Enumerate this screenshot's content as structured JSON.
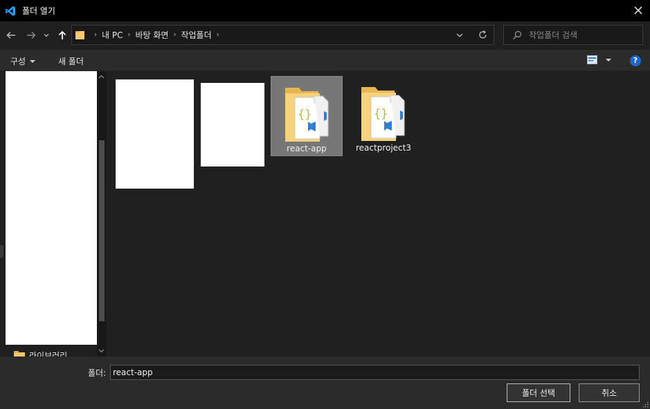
{
  "window": {
    "title": "폴더 열기"
  },
  "address": {
    "crumbs": [
      "내 PC",
      "바탕 화면",
      "작업폴더"
    ]
  },
  "search": {
    "placeholder": "작업폴더 검색"
  },
  "toolbar": {
    "organize_label": "구성",
    "new_folder_label": "새 폴더",
    "help_label": "?"
  },
  "navpane": {
    "library_label": "라이브러리"
  },
  "content": {
    "items": [
      {
        "label": "react-app",
        "selected": true
      },
      {
        "label": "reactproject3",
        "selected": false
      }
    ]
  },
  "footer": {
    "folder_label": "폴더:",
    "folder_value": "react-app",
    "select_button": "폴더 선택",
    "cancel_button": "취소"
  },
  "colors": {
    "accent": "#1e66c9",
    "selection": "#777777",
    "folder": "#f5c96a"
  }
}
